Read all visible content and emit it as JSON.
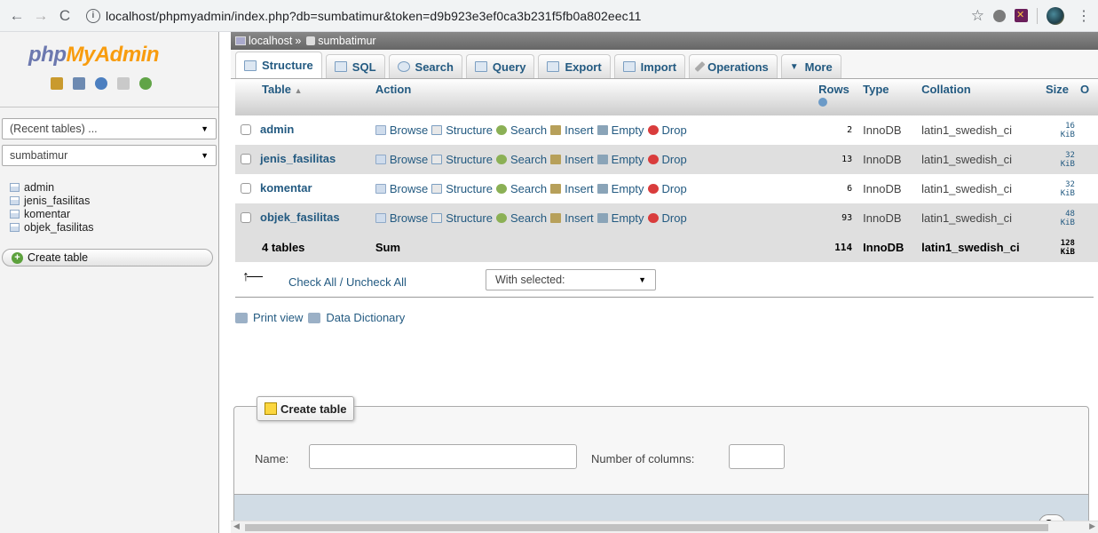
{
  "browser": {
    "url": "localhost/phpmyadmin/index.php?db=sumbatimur&token=d9b923e3ef0ca3b231f5fb0a802eec11"
  },
  "nav": {
    "logo_a": "php",
    "logo_b": "MyAdmin",
    "recent": "(Recent tables) ...",
    "db_select": "sumbatimur",
    "tables": [
      "admin",
      "jenis_fasilitas",
      "komentar",
      "objek_fasilitas"
    ],
    "create_table": "Create table"
  },
  "breadcrumb": {
    "server": "localhost",
    "sep": "»",
    "db": "sumbatimur"
  },
  "tabs": [
    "Structure",
    "SQL",
    "Search",
    "Query",
    "Export",
    "Import",
    "Operations",
    "More"
  ],
  "table_headers": {
    "table": "Table",
    "action": "Action",
    "rows": "Rows",
    "type": "Type",
    "collation": "Collation",
    "size": "Size",
    "overhead": "O"
  },
  "actions": [
    "Browse",
    "Structure",
    "Search",
    "Insert",
    "Empty",
    "Drop"
  ],
  "rows": [
    {
      "name": "admin",
      "rows": "2",
      "type": "InnoDB",
      "collation": "latin1_swedish_ci",
      "size_num": "16",
      "size_unit": "KiB"
    },
    {
      "name": "jenis_fasilitas",
      "rows": "13",
      "type": "InnoDB",
      "collation": "latin1_swedish_ci",
      "size_num": "32",
      "size_unit": "KiB"
    },
    {
      "name": "komentar",
      "rows": "6",
      "type": "InnoDB",
      "collation": "latin1_swedish_ci",
      "size_num": "32",
      "size_unit": "KiB"
    },
    {
      "name": "objek_fasilitas",
      "rows": "93",
      "type": "InnoDB",
      "collation": "latin1_swedish_ci",
      "size_num": "48",
      "size_unit": "KiB"
    }
  ],
  "summary": {
    "tables": "4 tables",
    "label": "Sum",
    "rows": "114",
    "type": "InnoDB",
    "collation": "latin1_swedish_ci",
    "size_num": "128",
    "size_unit": "KiB"
  },
  "bulk": {
    "check_all": "Check All / Uncheck All",
    "with_selected": "With selected:"
  },
  "links": {
    "print": "Print view",
    "dictionary": "Data Dictionary"
  },
  "create_form": {
    "legend": "Create table",
    "name_label": "Name:",
    "cols_label": "Number of columns:",
    "go": "Go"
  }
}
